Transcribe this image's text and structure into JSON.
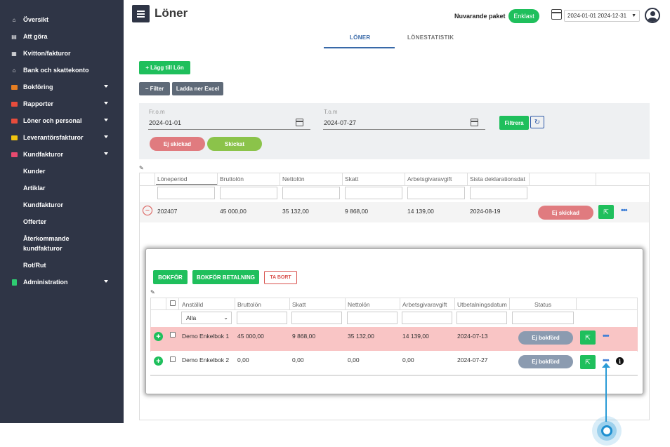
{
  "sidebar": {
    "items": [
      {
        "label": "Översikt",
        "icon": "home-icon",
        "glyph": "⌂",
        "color": "#ffffff",
        "caret": false
      },
      {
        "label": "Att göra",
        "icon": "todo-icon",
        "glyph": "▤",
        "color": "#ffffff",
        "caret": false
      },
      {
        "label": "Kvitton/fakturor",
        "icon": "receipt-icon",
        "glyph": "▦",
        "color": "#ffffff",
        "caret": false
      },
      {
        "label": "Bank och skattekonto",
        "icon": "bank-icon",
        "glyph": "⌂",
        "color": "#ffffff",
        "caret": false
      },
      {
        "label": "Bokföring",
        "icon": "bookkeeping-icon",
        "glyph": "",
        "color": "#e67e22",
        "caret": true
      },
      {
        "label": "Rapporter",
        "icon": "reports-icon",
        "glyph": "",
        "color": "#e74c3c",
        "caret": true
      },
      {
        "label": "Löner och personal",
        "icon": "payroll-icon",
        "glyph": "",
        "color": "#e74c3c",
        "caret": true
      },
      {
        "label": "Leverantörsfakturor",
        "icon": "supplier-invoices-icon",
        "glyph": "",
        "color": "#f1c40f",
        "caret": true
      },
      {
        "label": "Kundfakturor",
        "icon": "customer-invoices-icon",
        "glyph": "",
        "color": "#e84a6f",
        "caret": true
      }
    ],
    "sub_items": [
      "Kunder",
      "Artiklar",
      "Kundfakturor",
      "Offerter",
      "Återkommande kundfakturor",
      "Rot/Rut"
    ],
    "admin": {
      "label": "Administration",
      "icon": "administration-icon",
      "color": "#2ecc71"
    }
  },
  "header": {
    "title": "Löner",
    "paket_label": "Nuvarande paket",
    "paket_value": "Enklast",
    "date_range": "2024-01-01 2024-12-31"
  },
  "tabs": [
    {
      "label": "LÖNER",
      "active": true
    },
    {
      "label": "LÖNESTATISTIK",
      "active": false
    }
  ],
  "toolbar": {
    "add_label": "+ Lägg till Lön",
    "filter_label": "− Filter",
    "excel_label": "Ladda ner Excel"
  },
  "filter": {
    "from_label": "Fr.o.m",
    "from_value": "2024-01-01",
    "to_label": "T.o.m",
    "to_value": "2024-07-27",
    "filter_button": "Filtrera",
    "pill_unsent": "Ej skickad",
    "pill_sent": "Skickat"
  },
  "table": {
    "headers": [
      "Löneperiod",
      "Bruttolön",
      "Nettolön",
      "Skatt",
      "Arbetsgivaravgift",
      "Sista deklarationsdat"
    ],
    "row": {
      "period": "202407",
      "brutto": "45 000,00",
      "netto": "35 132,00",
      "skatt": "9 868,00",
      "avgift": "14 139,00",
      "deklaration": "2024-08-19",
      "status": "Ej skickad"
    }
  },
  "detail": {
    "bokfor_label": "BOKFÖR",
    "bokfor_betalning_label": "BOKFÖR BETALNING",
    "ta_bort_label": "TA BORT",
    "headers": [
      "Anställd",
      "Bruttolön",
      "Skatt",
      "Nettolön",
      "Arbetsgivaravgift",
      "Utbetalningsdatum",
      "Status"
    ],
    "employee_filter": "Alla",
    "rows": [
      {
        "name": "Demo Enkelbok 1",
        "brutto": "45 000,00",
        "skatt": "9 868,00",
        "netto": "35 132,00",
        "avgift": "14 139,00",
        "datum": "2024-07-13",
        "status": "Ej bokförd"
      },
      {
        "name": "Demo Enkelbok 2",
        "brutto": "0,00",
        "skatt": "0,00",
        "netto": "0,00",
        "avgift": "0,00",
        "datum": "2024-07-27",
        "status": "Ej bokförd"
      }
    ]
  },
  "colors": {
    "sidebar_bg": "#2f3546",
    "accent_green": "#1fbf5c",
    "accent_blue": "#3869a8",
    "danger_pink": "#e07b7f",
    "sent_green": "#8bc34a",
    "row_highlight": "#f9c5c5",
    "status_gray": "#8b9bb0"
  }
}
